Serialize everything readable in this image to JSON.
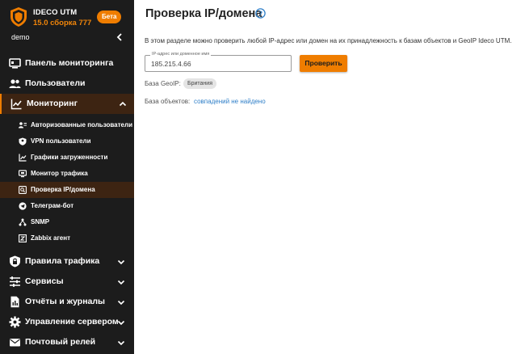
{
  "brand": {
    "name": "IDECO UTM",
    "version": "15.0 сборка 777",
    "badge": "Бета",
    "accent": "#ef7d00"
  },
  "user": {
    "name": "demo"
  },
  "nav": {
    "monitoring_panel": "Панель мониторинга",
    "users": "Пользователи",
    "monitoring": "Мониторинг",
    "sub": {
      "authorized_users": "Авторизованные пользователи",
      "vpn_users": "VPN пользователи",
      "load_graphs": "Графики загруженности",
      "traffic_monitor": "Монитор трафика",
      "ip_check": "Проверка IP/домена",
      "telegram_bot": "Телеграм-бот",
      "snmp": "SNMP",
      "zabbix": "Zabbix агент"
    },
    "traffic_rules": "Правила трафика",
    "services": "Сервисы",
    "reports": "Отчёты и журналы",
    "server_mgmt": "Управление сервером",
    "mail_relay": "Почтовый релей"
  },
  "main": {
    "title": "Проверка IP/домена",
    "description": "В этом разделе можно проверить любой IP-адрес или домен на их принадлежность к базам объектов и GeoIP Ideco UTM.",
    "input_label": "IP-адрес или доменное имя",
    "input_value": "185.215.4.66",
    "check_button": "Проверить",
    "geoip_label": "База GeoIP:",
    "geoip_value": "Британия",
    "objects_label": "База объектов:",
    "objects_value": "совпадений не найдено"
  }
}
